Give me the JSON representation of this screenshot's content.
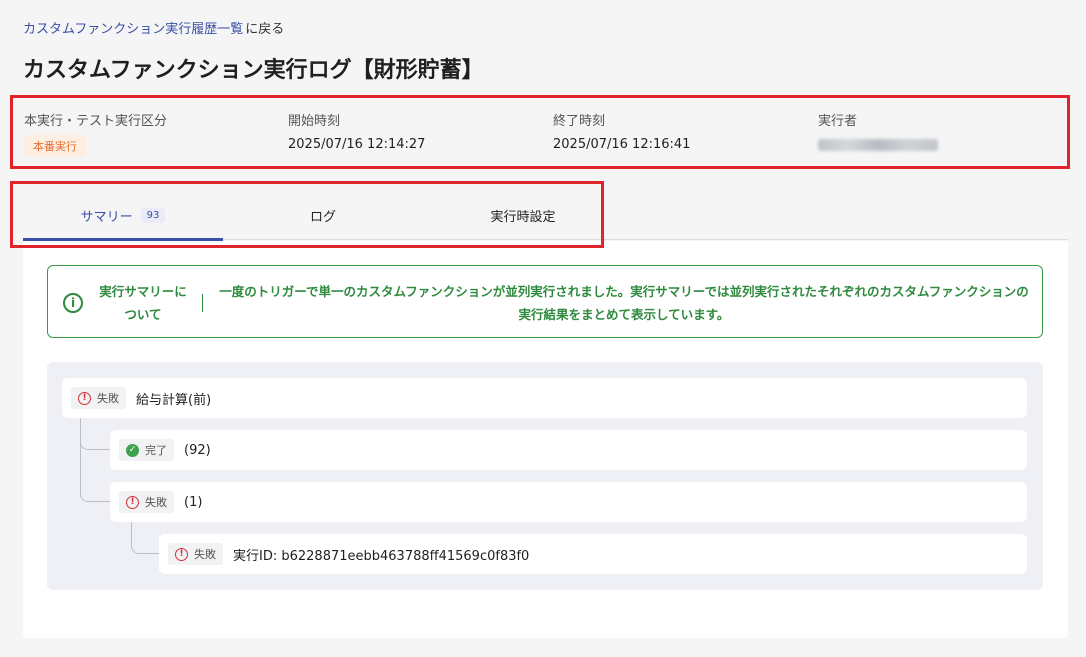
{
  "breadcrumb": {
    "link": "カスタムファンクション実行履歴一覧",
    "suffix": "に戻る"
  },
  "title": "カスタムファンクション実行ログ【財形貯蓄】",
  "meta": {
    "run_type_label": "本実行・テスト実行区分",
    "run_type_value": "本番実行",
    "start_label": "開始時刻",
    "start_value": "2025/07/16 12:14:27",
    "end_label": "終了時刻",
    "end_value": "2025/07/16 12:16:41",
    "executor_label": "実行者"
  },
  "tabs": [
    {
      "label": "サマリー",
      "count": "93",
      "active": true
    },
    {
      "label": "ログ"
    },
    {
      "label": "実行時設定"
    }
  ],
  "info": {
    "title": "実行サマリーについて",
    "text": "一度のトリガーで単一のカスタムファンクションが並列実行されました。実行サマリーでは並列実行されたそれぞれのカスタムファンクションの実行結果をまとめて表示しています。"
  },
  "tree": [
    {
      "status": "失敗",
      "status_type": "fail",
      "text": "給与計算(前)"
    },
    {
      "status": "完了",
      "status_type": "ok",
      "text": "(92)"
    },
    {
      "status": "失敗",
      "status_type": "fail",
      "text": "(1)"
    },
    {
      "status": "失敗",
      "status_type": "fail",
      "text": "実行ID: b6228871eebb463788ff41569c0f83f0"
    }
  ],
  "colors": {
    "accent": "#3a4fa6",
    "highlight": "#e0242b",
    "success": "#2e8a3e",
    "fail": "#d0303a"
  }
}
